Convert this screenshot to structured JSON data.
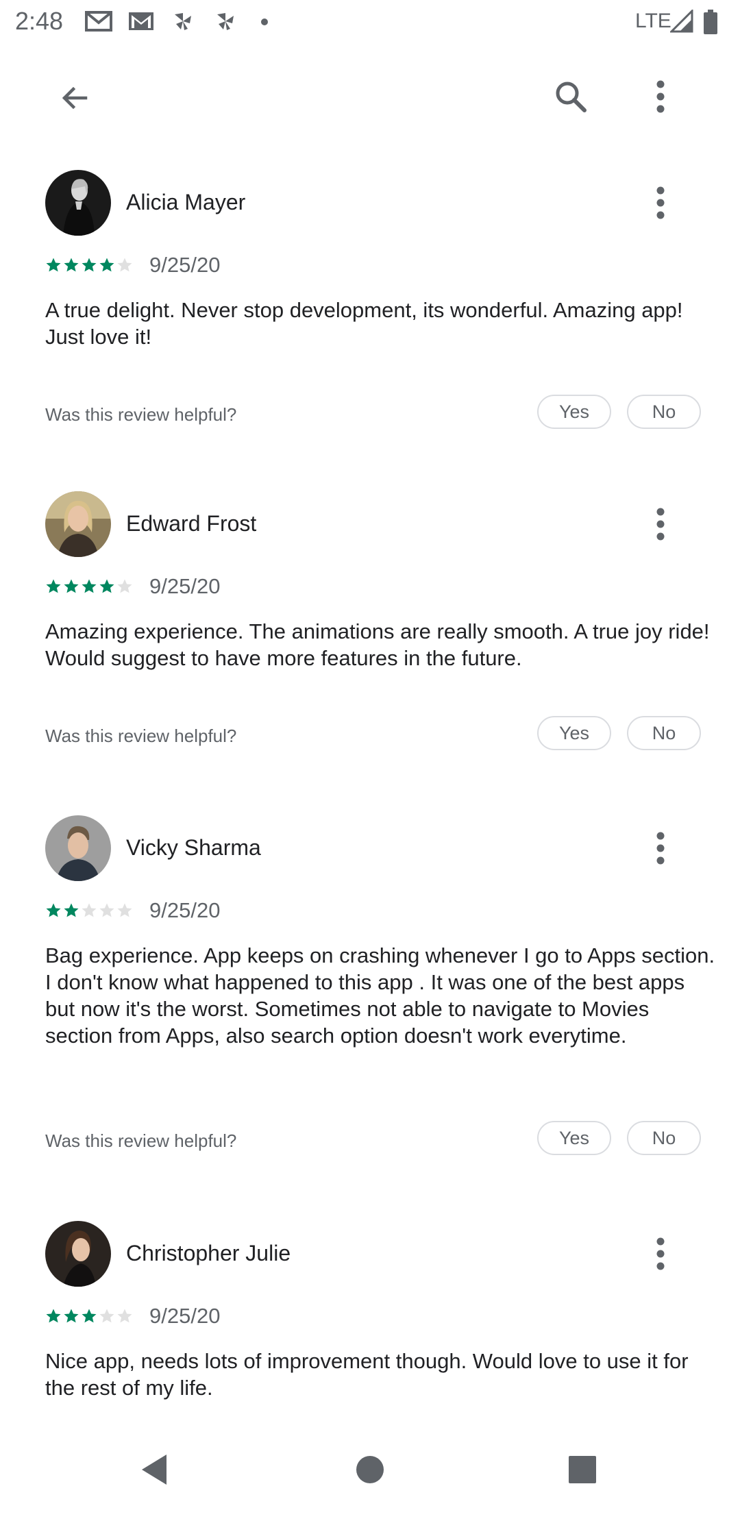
{
  "status_bar": {
    "time": "2:48",
    "network": "LTE",
    "icons": [
      "gmail-icon",
      "gmail-icon",
      "pinwheel-icon",
      "pinwheel-icon",
      "notification-dot-icon",
      "signal-icon",
      "battery-icon"
    ]
  },
  "app_bar": {
    "icons": [
      "back-arrow-icon",
      "search-icon",
      "more-vert-icon"
    ]
  },
  "reviews": [
    {
      "name": "Alicia Mayer",
      "rating": 4,
      "date": "9/25/20",
      "text": "A true delight. Never stop development, its wonderful. Amazing app! Just love it!",
      "helpful_prompt": "Was this review helpful?",
      "yes_label": "Yes",
      "no_label": "No"
    },
    {
      "name": "Edward Frost",
      "rating": 4,
      "date": "9/25/20",
      "text": "Amazing experience. The animations are really smooth. A true joy ride! Would suggest to have more features in the future.",
      "helpful_prompt": "Was this review helpful?",
      "yes_label": "Yes",
      "no_label": "No"
    },
    {
      "name": "Vicky Sharma",
      "rating": 2,
      "date": "9/25/20",
      "text": "Bag experience. App keeps on crashing whenever I go to Apps section. I don't know what happened to this app . It was one of the best apps but now it's the worst. Sometimes not able to navigate to Movies section from Apps, also search option doesn't work everytime.",
      "helpful_prompt": "Was this review helpful?",
      "yes_label": "Yes",
      "no_label": "No"
    },
    {
      "name": "Christopher Julie",
      "rating": 3,
      "date": "9/25/20",
      "text": "Nice app, needs lots of improvement though. Would love to use it for the rest of my life."
    }
  ],
  "rating_max": 5,
  "colors": {
    "star_filled": "#01875f",
    "star_empty": "#e0e0e0",
    "secondary_text": "#5f6368",
    "pill_border": "#dadce0"
  },
  "nav_bar": {
    "icons": [
      "nav-back-icon",
      "nav-home-icon",
      "nav-recents-icon"
    ]
  }
}
